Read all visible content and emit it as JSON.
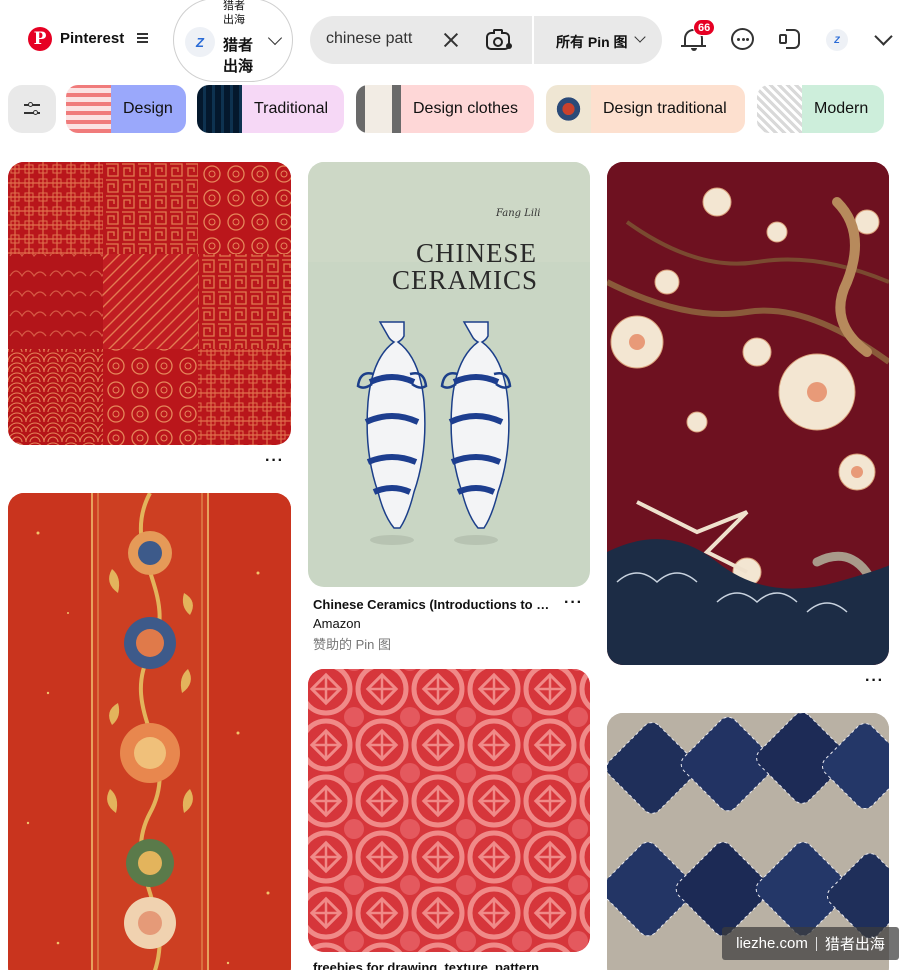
{
  "header": {
    "brand": "Pinterest",
    "account": {
      "name_small": "猎者出海",
      "name_big": "猎者出海",
      "avatar_text": "Z"
    },
    "search": {
      "query": "chinese patt",
      "scope": "所有 Pin 图"
    },
    "notifications_count": "66",
    "mini_avatar_text": "Z"
  },
  "chips": [
    {
      "label": "Design",
      "bg": "#9aa8fb"
    },
    {
      "label": "Traditional",
      "bg": "#f6d8f6"
    },
    {
      "label": "Design clothes",
      "bg": "#fed7d7"
    },
    {
      "label": "Design traditional",
      "bg": "#fde0cf"
    },
    {
      "label": "Modern",
      "bg": "#cdeedb"
    }
  ],
  "pins": {
    "ceramics": {
      "book_author": "Fang Lili",
      "book_title_1": "CHINESE",
      "book_title_2": "CERAMICS",
      "title": "Chinese Ceramics (Introductions to Chinese Culture)",
      "source": "Amazon",
      "promoted": "赞助的 Pin 图"
    },
    "knot": {
      "title": "freebies for drawing, texture, pattern"
    }
  },
  "watermark": {
    "site": "liezhe.com",
    "brand": "猎者出海"
  }
}
